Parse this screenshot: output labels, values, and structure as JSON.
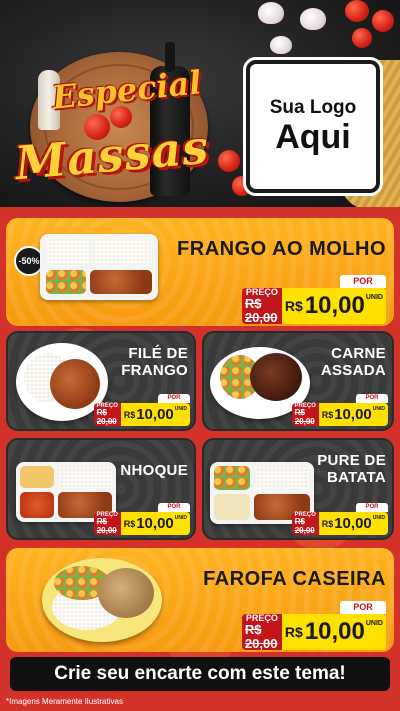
{
  "header": {
    "title_line1": "Especial",
    "title_line2": "Massas",
    "logo_line1": "Sua Logo",
    "logo_line2": "Aqui"
  },
  "items": [
    {
      "name": "FRANGO AO MOLHO",
      "badge": "-50%",
      "old_label": "PREÇO",
      "old_price": "R$ 20,00",
      "por": "POR",
      "currency": "R$",
      "price": "10,00",
      "unit": "UNID"
    },
    {
      "name_l1": "FILÉ DE",
      "name_l2": "FRANGO",
      "old_label": "PREÇO",
      "old_price": "R$ 20,00",
      "por": "POR",
      "currency": "R$",
      "price": "10,00",
      "unit": "UNID"
    },
    {
      "name_l1": "CARNE",
      "name_l2": "ASSADA",
      "old_label": "PREÇO",
      "old_price": "R$ 20,00",
      "por": "POR",
      "currency": "R$",
      "price": "10,00",
      "unit": "UNID"
    },
    {
      "name": "NHOQUE",
      "old_label": "PREÇO",
      "old_price": "R$ 20,00",
      "por": "POR",
      "currency": "R$",
      "price": "10,00",
      "unit": "UNID"
    },
    {
      "name_l1": "PURE DE",
      "name_l2": "BATATA",
      "old_label": "PREÇO",
      "old_price": "R$ 20,00",
      "por": "POR",
      "currency": "R$",
      "price": "10,00",
      "unit": "UNID"
    },
    {
      "name": "FAROFA CASEIRA",
      "old_label": "PREÇO",
      "old_price": "R$ 20,00",
      "por": "POR",
      "currency": "R$",
      "price": "10,00",
      "unit": "UNID"
    }
  ],
  "cta": "Crie seu encarte com este tema!",
  "disclaimer": "*Imagens Meramente Ilustrativas",
  "colors": {
    "accent_red": "#c3161b",
    "price_yellow": "#ffe100",
    "card_orange": "#f9a51a",
    "card_dark": "#3a3a3a"
  }
}
